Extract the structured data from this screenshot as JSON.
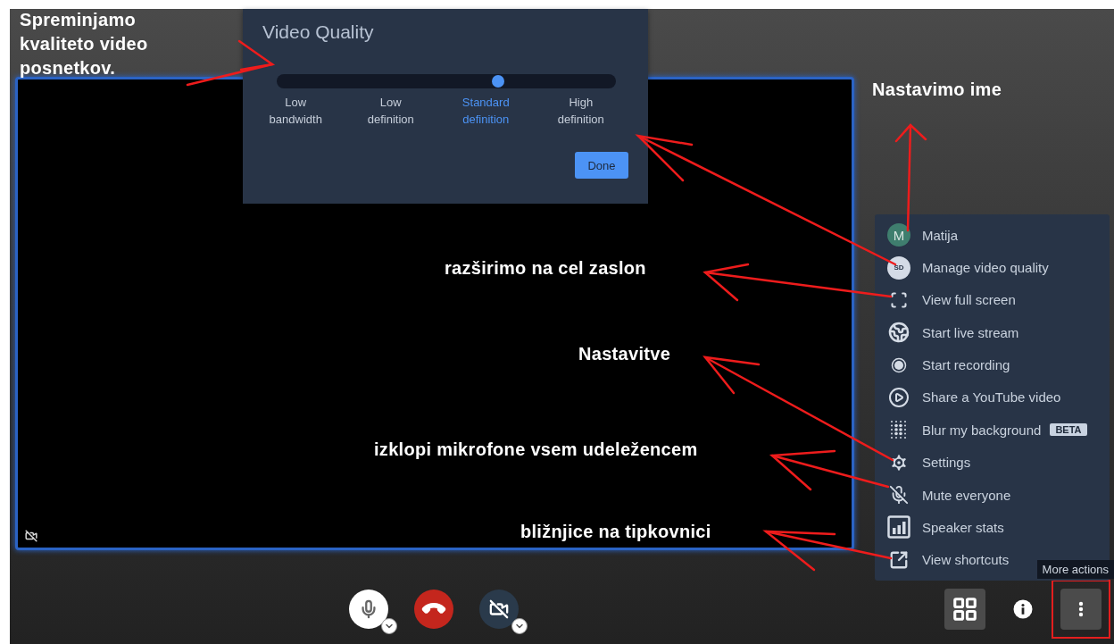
{
  "quality_dialog": {
    "title": "Video Quality",
    "level": 0.667,
    "options": [
      {
        "label": "Low bandwidth",
        "selected": false
      },
      {
        "label": "Low definition",
        "selected": false
      },
      {
        "label": "Standard definition",
        "selected": true
      },
      {
        "label": "High definition",
        "selected": false
      }
    ],
    "done_button": "Done"
  },
  "menu": {
    "items": [
      {
        "kind": "avatar",
        "initial": "M",
        "label": "Matija"
      },
      {
        "kind": "quality",
        "icon_text": "SD",
        "label": "Manage video quality"
      },
      {
        "kind": "action",
        "label": "View full screen"
      },
      {
        "kind": "action",
        "label": "Start live stream"
      },
      {
        "kind": "action",
        "label": "Start recording"
      },
      {
        "kind": "action",
        "label": "Share a YouTube video"
      },
      {
        "kind": "action",
        "label": "Blur my background",
        "badge": "BETA"
      },
      {
        "kind": "action",
        "label": "Settings"
      },
      {
        "kind": "action",
        "label": "Mute everyone"
      },
      {
        "kind": "action",
        "label": "Speaker stats"
      },
      {
        "kind": "action",
        "label": "View shortcuts"
      }
    ]
  },
  "tooltip": "More actions",
  "toolbar": {
    "left": [
      {
        "kind": "microphone",
        "on": true
      },
      {
        "kind": "hangup"
      },
      {
        "kind": "camera",
        "on": false
      }
    ],
    "right": [
      {
        "kind": "tile_view",
        "highlighted": false
      },
      {
        "kind": "info",
        "highlighted": false
      },
      {
        "kind": "more",
        "highlighted": true
      }
    ]
  },
  "annotations": [
    {
      "text": "Spreminjamo kvaliteto video posnetkov."
    },
    {
      "text": "Nastavimo ime"
    },
    {
      "text": "razširimo na cel zaslon"
    },
    {
      "text": "Nastavitve"
    },
    {
      "text": "izklopi mikrofone vsem udeležencem"
    },
    {
      "text": "bližnjice na tipkovnici"
    }
  ]
}
